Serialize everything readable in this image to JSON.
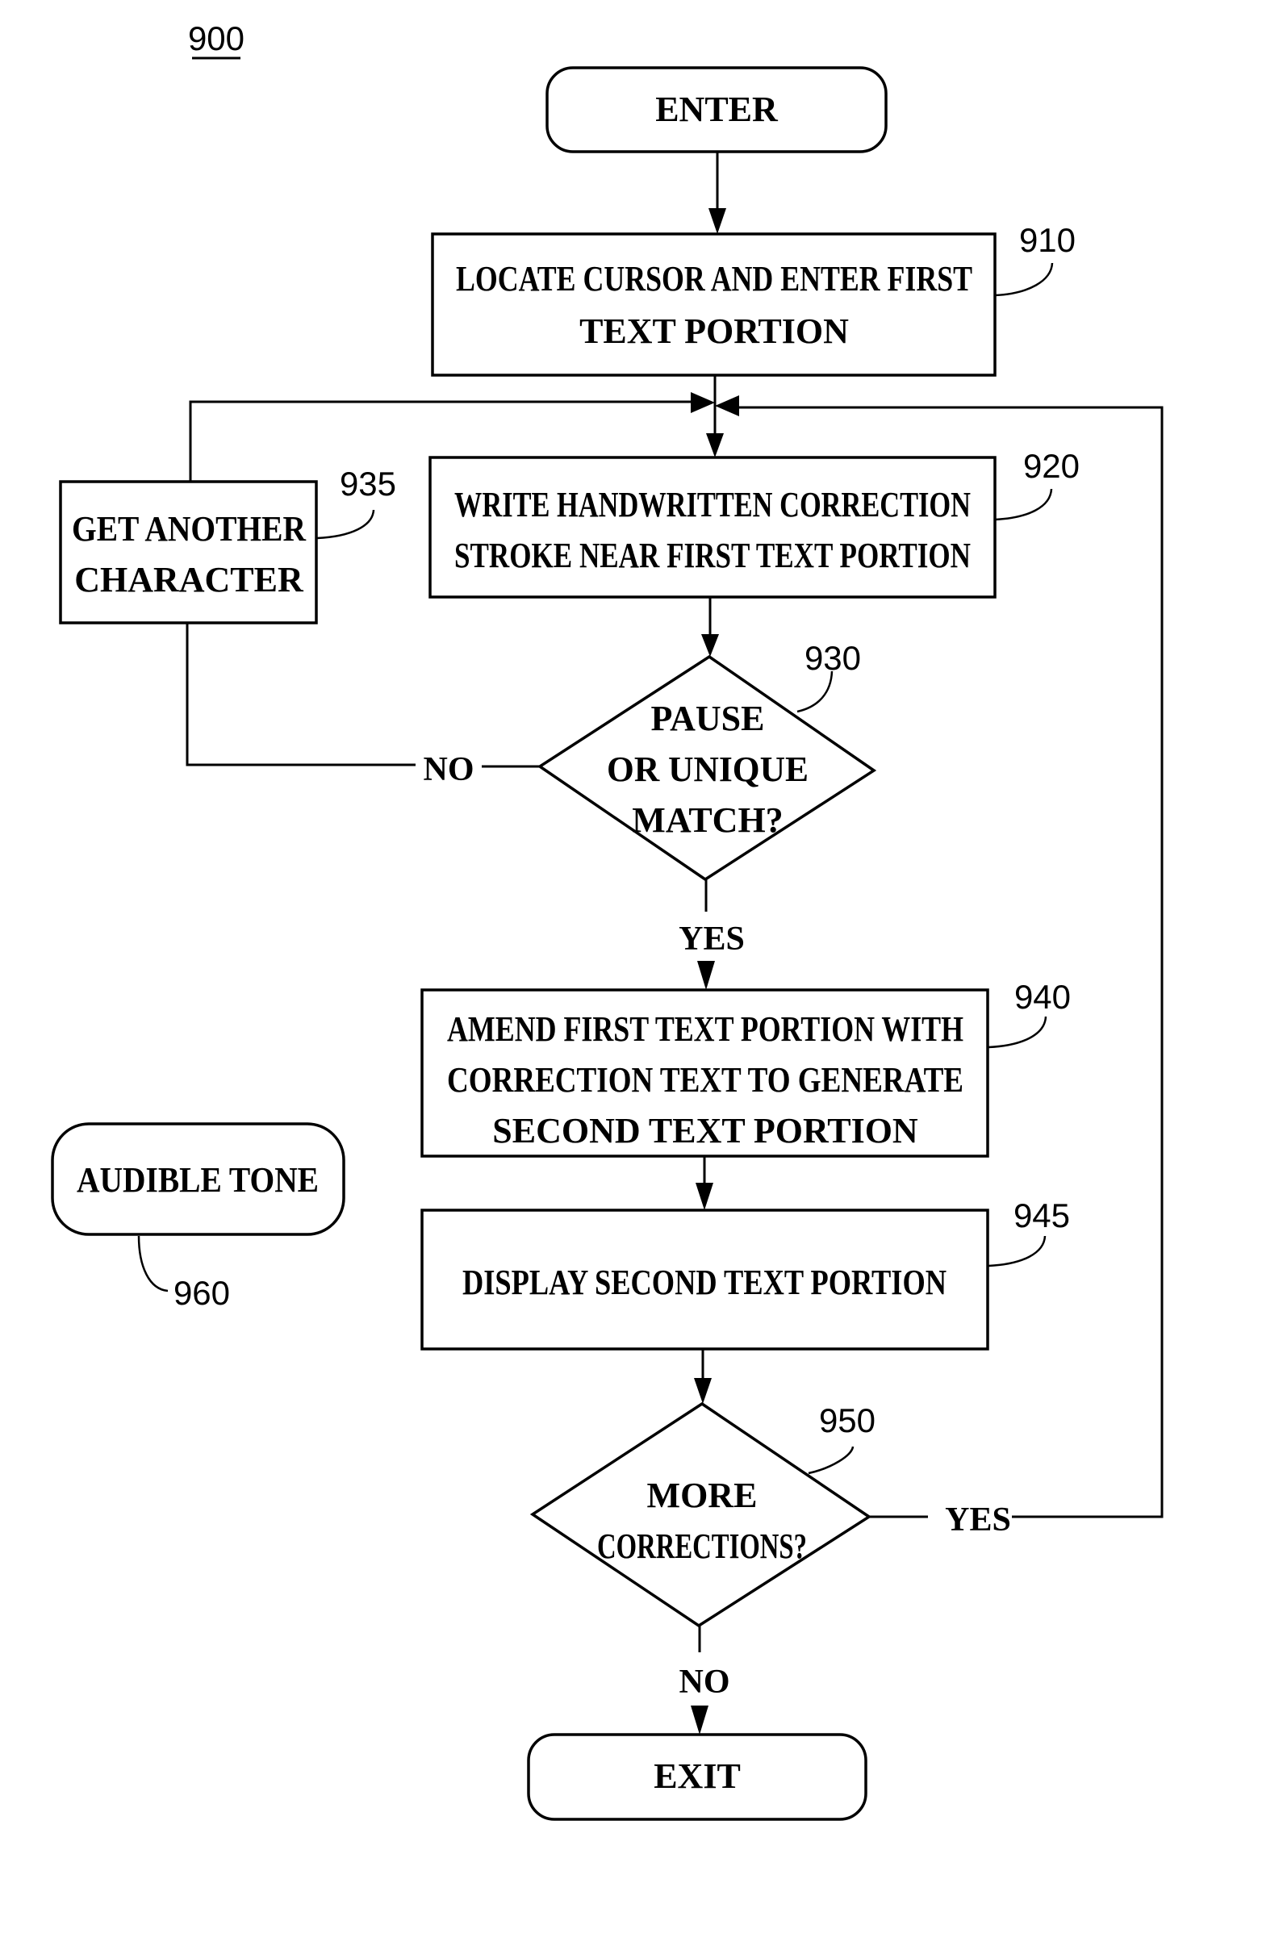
{
  "figure": {
    "number": "900",
    "colors": {
      "ink": "#000000",
      "paper": "#ffffff"
    }
  },
  "nodes": {
    "enter": {
      "ref": "",
      "type": "terminal",
      "lines": [
        "ENTER"
      ]
    },
    "n910": {
      "ref": "910",
      "type": "process",
      "lines": [
        "LOCATE CURSOR AND ENTER FIRST",
        "TEXT PORTION"
      ]
    },
    "n920": {
      "ref": "920",
      "type": "process",
      "lines": [
        "WRITE HANDWRITTEN CORRECTION",
        "STROKE NEAR FIRST TEXT PORTION"
      ]
    },
    "n935": {
      "ref": "935",
      "type": "process",
      "lines": [
        "GET ANOTHER",
        "CHARACTER"
      ]
    },
    "n930": {
      "ref": "930",
      "type": "decision",
      "lines": [
        "PAUSE",
        "OR UNIQUE",
        "MATCH?"
      ]
    },
    "n940": {
      "ref": "940",
      "type": "process",
      "lines": [
        "AMEND FIRST TEXT PORTION WITH",
        "CORRECTION TEXT TO GENERATE",
        "SECOND TEXT PORTION"
      ]
    },
    "n945": {
      "ref": "945",
      "type": "process",
      "lines": [
        "DISPLAY SECOND TEXT PORTION"
      ]
    },
    "n950": {
      "ref": "950",
      "type": "decision",
      "lines": [
        "MORE",
        "CORRECTIONS?"
      ]
    },
    "exit": {
      "ref": "",
      "type": "terminal",
      "lines": [
        "EXIT"
      ]
    },
    "n960": {
      "ref": "960",
      "type": "terminal",
      "lines": [
        "AUDIBLE TONE"
      ]
    }
  },
  "edges": {
    "n930_no": "NO",
    "n930_yes": "YES",
    "n950_yes": "YES",
    "n950_no": "NO"
  }
}
